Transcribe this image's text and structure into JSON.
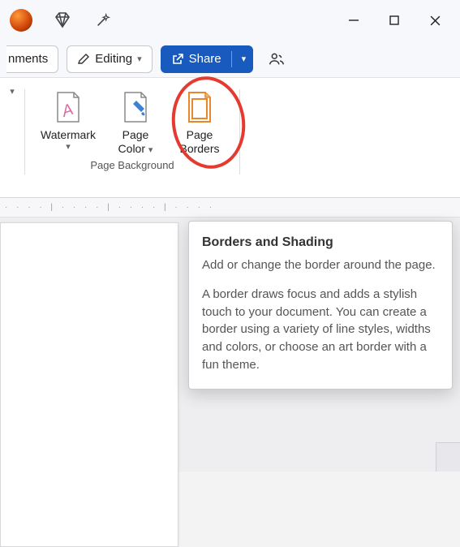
{
  "titlebar": {
    "autosave_icon": "autosave-orb",
    "premium_icon": "diamond",
    "magic_icon": "wand",
    "min": "minimize",
    "max": "maximize",
    "close": "close"
  },
  "toolbar": {
    "comments_label": "nments",
    "editing_label": "Editing",
    "share_label": "Share",
    "collab_icon": "people"
  },
  "ribbon": {
    "split_chevron": "▾",
    "group_label": "Page Background",
    "items": [
      {
        "label_line1": "Watermark",
        "label_line2": "",
        "has_chev": true
      },
      {
        "label_line1": "Page",
        "label_line2": "Color",
        "has_chev": true
      },
      {
        "label_line1": "Page",
        "label_line2": "Borders",
        "has_chev": false
      }
    ]
  },
  "tooltip": {
    "title": "Borders and Shading",
    "p1": "Add or change the border around the page.",
    "p2": "A border draws focus and adds a stylish touch to your document. You can create a border using a variety of line styles, widths and colors, or choose an art border with a fun theme."
  },
  "ruler_ticks": "· · · · | · · · · | · · · · | · · · ·"
}
